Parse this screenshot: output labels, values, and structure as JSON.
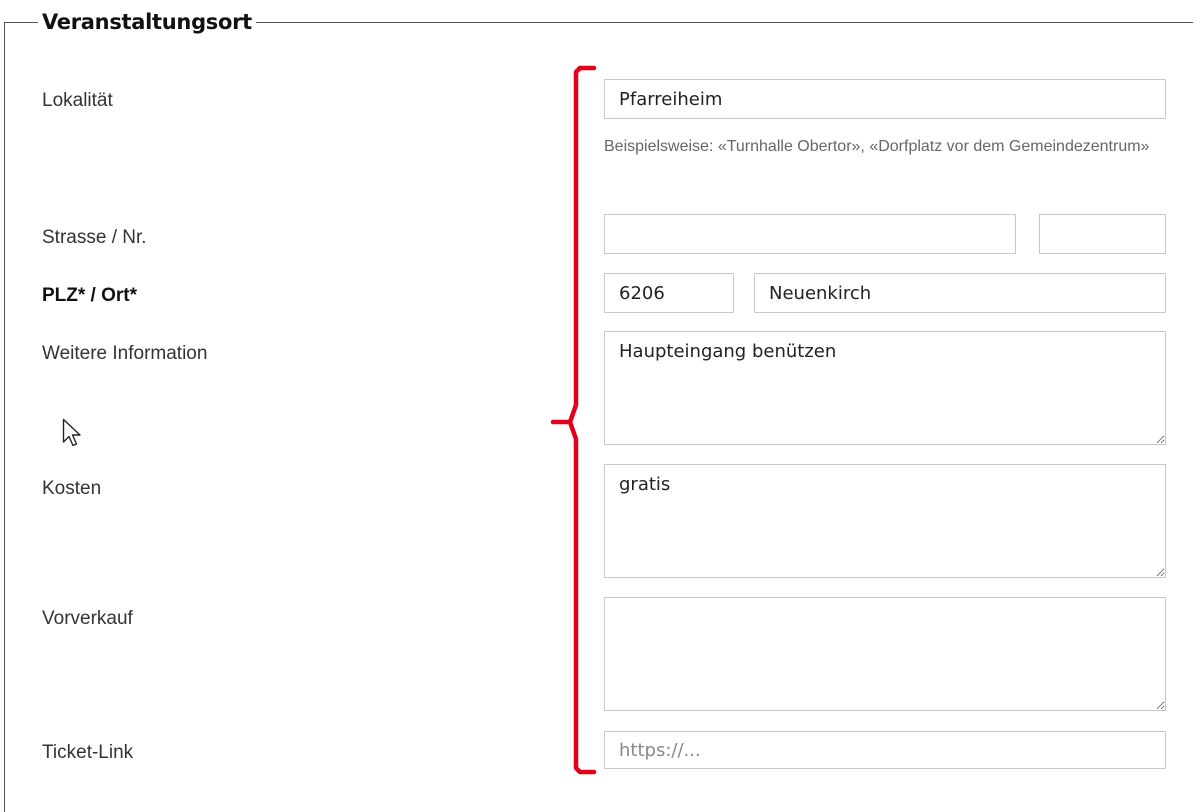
{
  "section": {
    "legend": "Veranstaltungsort"
  },
  "fields": {
    "lokalitaet": {
      "label": "Lokalität",
      "value": "Pfarreiheim",
      "help": "Beispielsweise: «Turnhalle Obertor», «Dorfplatz vor dem Gemeindezentrum»"
    },
    "strasse": {
      "label": "Strasse / Nr.",
      "street_value": "",
      "number_value": ""
    },
    "plz_ort": {
      "label": "PLZ* / Ort*",
      "plz_value": "6206",
      "ort_value": "Neuenkirch"
    },
    "weitere_information": {
      "label": "Weitere Information",
      "value": "Haupteingang benützen"
    },
    "kosten": {
      "label": "Kosten",
      "value": "gratis"
    },
    "vorverkauf": {
      "label": "Vorverkauf",
      "value": ""
    },
    "ticket_link": {
      "label": "Ticket-Link",
      "value": "",
      "placeholder": "https://..."
    }
  },
  "annotation": {
    "color": "#e3001b",
    "shape": "right-curly-brace"
  },
  "icons": {
    "cursor": "mouse-pointer-icon"
  }
}
